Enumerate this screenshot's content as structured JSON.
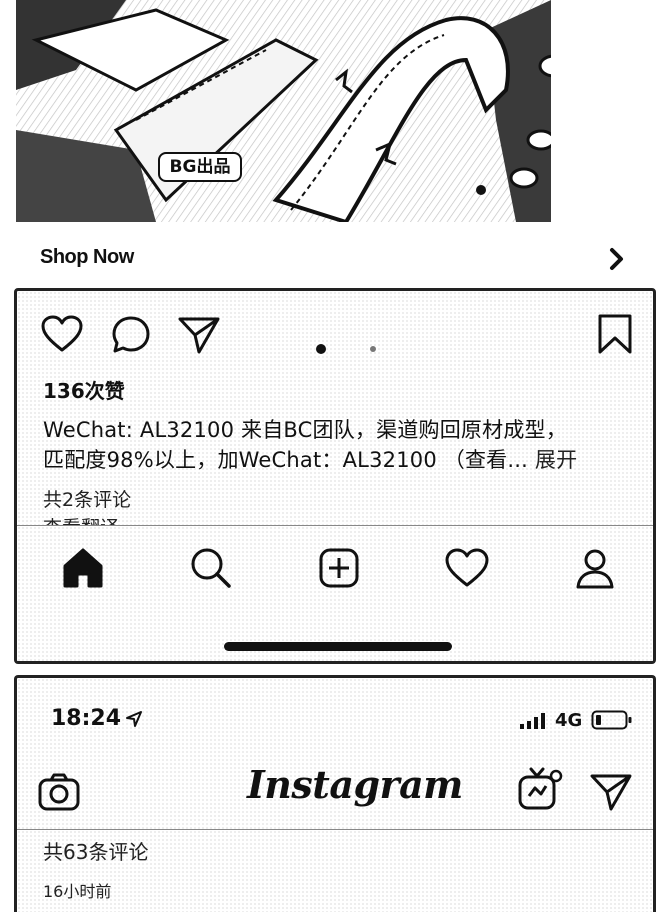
{
  "ad": {
    "brand_badge": "BG出品",
    "shop_now_label": "Shop Now",
    "image_icon": "sneaker-closeup-image"
  },
  "post": {
    "likes": "136次赞",
    "caption_line1": "WeChat: AL32100 来自BC团队，渠道购回原材成型，",
    "caption_line2": "匹配度98%以上，加WeChat：AL32100 （查看...",
    "more_label": "展开",
    "comments_link": "共2条评论",
    "cut_text": "查看翻译",
    "carousel": {
      "pages": 2,
      "active": 0
    }
  },
  "tab_bar": {
    "items": [
      "home-icon",
      "search-icon",
      "add-post-icon",
      "activity-heart-icon",
      "profile-icon"
    ],
    "active": 0
  },
  "status_bar": {
    "time": "18:24",
    "network": "4G"
  },
  "ig_header": {
    "logo_text": "Instagram"
  },
  "second_post": {
    "comments_count": "共63条评论",
    "timestamp": "16小时前"
  },
  "colors": {
    "ink": "#111111",
    "screen_texture": "#b9b9b9"
  }
}
